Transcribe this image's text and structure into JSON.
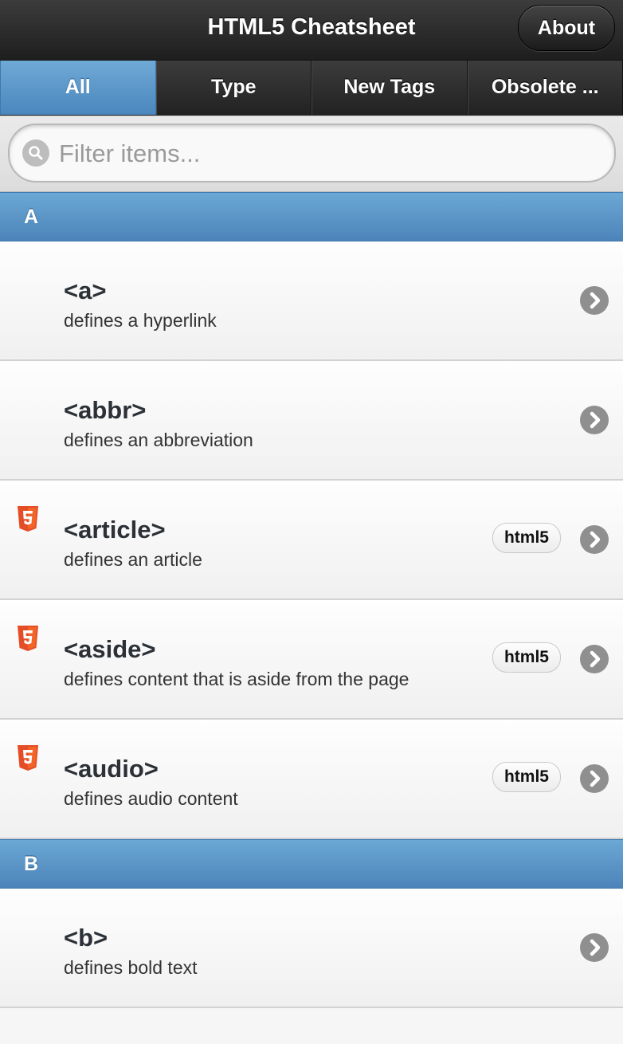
{
  "header": {
    "title": "HTML5 Cheatsheet",
    "about_label": "About"
  },
  "tabs": [
    {
      "label": "All",
      "active": true
    },
    {
      "label": "Type",
      "active": false
    },
    {
      "label": "New Tags",
      "active": false
    },
    {
      "label": "Obsolete ...",
      "active": false
    }
  ],
  "filter": {
    "placeholder": "Filter items...",
    "value": ""
  },
  "sections": [
    {
      "letter": "A",
      "items": [
        {
          "tag": "<a>",
          "desc": "defines a hyperlink",
          "html5": false
        },
        {
          "tag": "<abbr>",
          "desc": "defines an abbreviation",
          "html5": false
        },
        {
          "tag": "<article>",
          "desc": "defines an article",
          "html5": true,
          "badge": "html5"
        },
        {
          "tag": "<aside>",
          "desc": "defines content that is aside from the page",
          "html5": true,
          "badge": "html5"
        },
        {
          "tag": "<audio>",
          "desc": "defines audio content",
          "html5": true,
          "badge": "html5"
        }
      ]
    },
    {
      "letter": "B",
      "items": [
        {
          "tag": "<b>",
          "desc": "defines bold text",
          "html5": false
        }
      ]
    }
  ],
  "colors": {
    "accent_blue": "#5b97ca",
    "html5_orange": "#e44d26",
    "header_dark": "#2a2a2a"
  }
}
